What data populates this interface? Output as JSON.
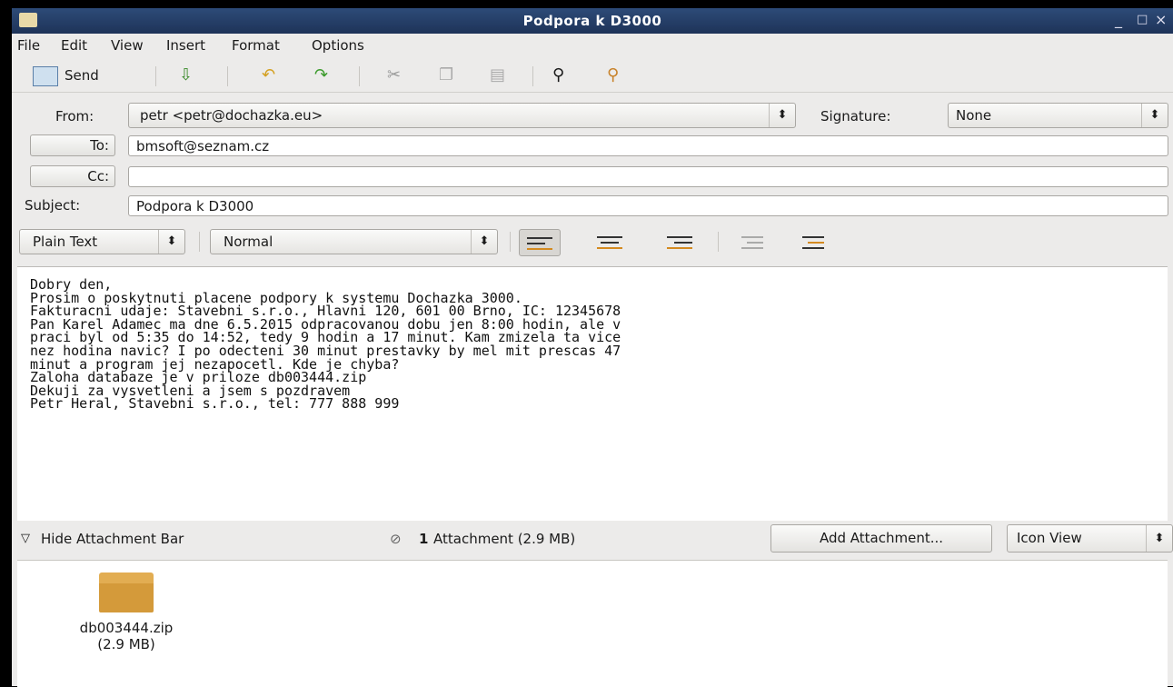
{
  "window": {
    "title": "Podpora k D3000",
    "min": "_",
    "max": "□",
    "close": "×"
  },
  "menu": [
    "File",
    "Edit",
    "View",
    "Insert",
    "Format",
    "Options"
  ],
  "toolbar": {
    "send_label": "Send"
  },
  "header": {
    "from_label": "From:",
    "from_value": "petr <petr@dochazka.eu>",
    "signature_label": "Signature:",
    "signature_value": "None",
    "to_label": "To:",
    "to_value": "bmsoft@seznam.cz",
    "cc_label": "Cc:",
    "cc_value": "",
    "subject_label": "Subject:",
    "subject_value": "Podpora k D3000"
  },
  "format": {
    "mode": "Plain Text",
    "paragraph": "Normal",
    "arrow": "⬍"
  },
  "message": {
    "lines": [
      "Dobry den,",
      "",
      "Prosim o poskytnuti placene podpory k systemu Dochazka 3000.",
      "Fakturacni udaje: Stavebni s.r.o., Hlavni 120, 601 00 Brno, IC: 12345678",
      "",
      "Pan Karel Adamec ma dne 6.5.2015 odpracovanou dobu jen 8:00 hodin, ale v",
      "praci byl od 5:35 do 14:52, tedy 9 hodin a 17 minut. Kam zmizela ta vice",
      "nez hodina navic? I po odecteni 30 minut prestavky by mel mit prescas 47",
      "minut a program jej nezapocetl. Kde je chyba?",
      "",
      "Zaloha databaze je v priloze db003444.zip",
      "",
      "Dekuji za vysvetleni a jsem s pozdravem",
      "Petr Heral, Stavebni s.r.o., tel: 777 888 999"
    ]
  },
  "attachments": {
    "hide_label": "Hide Attachment Bar",
    "count": "1",
    "summary": "Attachment (2.9 MB)",
    "add_label": "Add Attachment...",
    "view_label": "Icon View",
    "items": [
      {
        "name": "db003444.zip",
        "size": "(2.9 MB)"
      }
    ]
  }
}
